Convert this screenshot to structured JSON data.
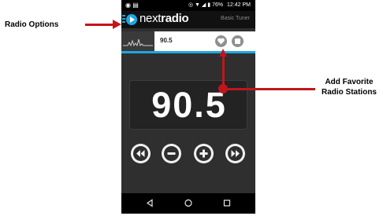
{
  "callouts": {
    "radio_options": "Radio Options",
    "add_favorite_line1": "Add Favorite",
    "add_favorite_line2": "Radio Stations"
  },
  "status_bar": {
    "battery": "76%",
    "time": "12:42 PM"
  },
  "app": {
    "logo_prefix": "next",
    "logo_suffix": "radio",
    "mode_label": "Basic Tuner"
  },
  "now_playing": {
    "frequency": "90.5"
  },
  "tuner": {
    "frequency": "90.5"
  },
  "controls": [
    "rewind-icon",
    "minus-icon",
    "plus-icon",
    "fast-forward-icon"
  ],
  "nav": [
    "back-icon",
    "home-icon",
    "recent-apps-icon"
  ],
  "colors": {
    "accent": "#1ea7e1",
    "arrow": "#c0161b"
  }
}
